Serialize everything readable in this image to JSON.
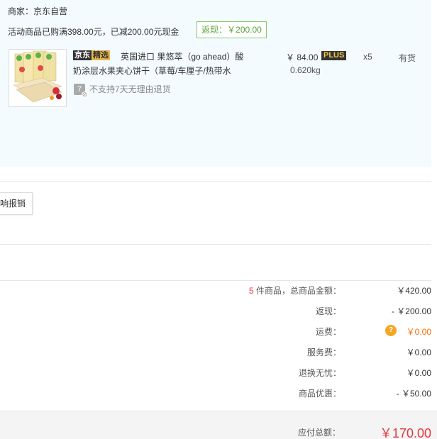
{
  "order": {
    "seller": "商家：京东自营",
    "promo": "活动商品已购满398.00元，已减200.00元现金",
    "rebate_tag": "返现：￥200.00",
    "item": {
      "badge_left": "京东",
      "badge_right": "精选",
      "title_line1": "英国进口 果悠萃（go ahead）酸",
      "title_line2": "奶涂层水果夹心饼干（草莓/车厘子/热带水",
      "no_return_icon": "7",
      "no_return_text": "不支持7天无理由退货",
      "price": "￥ 84.00",
      "plus_badge": "PLUS",
      "weight": "0.620kg",
      "quantity": "x5",
      "stock": "有货"
    }
  },
  "invoice": {
    "button_label": "响报销"
  },
  "summary": {
    "goods_count": "5",
    "goods_label": " 件商品，总商品金额：",
    "goods_total": "￥420.00",
    "rebate_label": "返现：",
    "rebate_value": "- ￥200.00",
    "freight_label": "运费：",
    "freight_help": "?",
    "freight_value": "￥0.00",
    "service_label": "服务费：",
    "service_value": "￥0.00",
    "return_label": "退换无忧：",
    "return_value": "￥0.00",
    "discount_label": "商品优惠：",
    "discount_value": "- ￥50.00",
    "payable_label": "应付总额：",
    "payable_value": "￥170.00"
  },
  "colors": {
    "panel_bg": "#f3fbfe",
    "accent_red": "#e4393c",
    "rebate_green": "#5aa33b",
    "freight_orange": "#ff6a00"
  }
}
